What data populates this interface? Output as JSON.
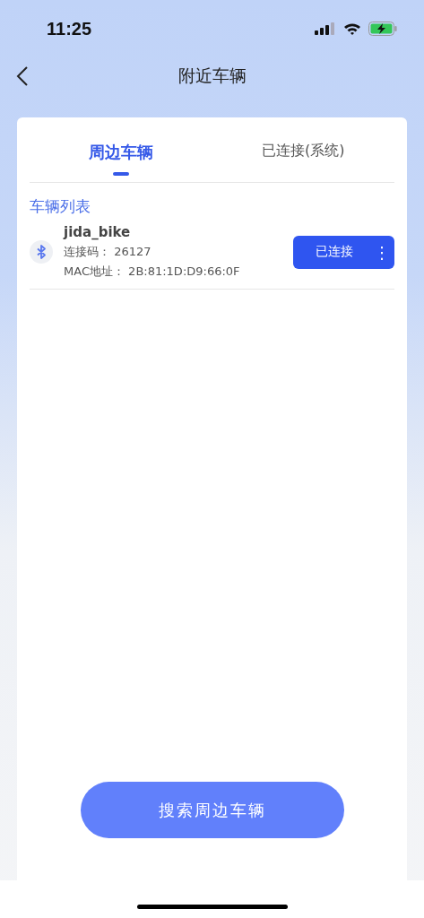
{
  "status_bar": {
    "time": "11:25"
  },
  "nav": {
    "title": "附近车辆"
  },
  "tabs": [
    {
      "label": "周边车辆",
      "selected": true
    },
    {
      "label": "已连接(系统)",
      "selected": false
    }
  ],
  "section_title": "车辆列表",
  "devices": [
    {
      "name": "jida_bike",
      "code_label": "连接码：",
      "code": "26127",
      "mac_label": "MAC地址：",
      "mac": "2B:81:1D:D9:66:0F",
      "action": "已连接",
      "more": "⋮"
    }
  ],
  "search_button": "搜索周边车辆"
}
